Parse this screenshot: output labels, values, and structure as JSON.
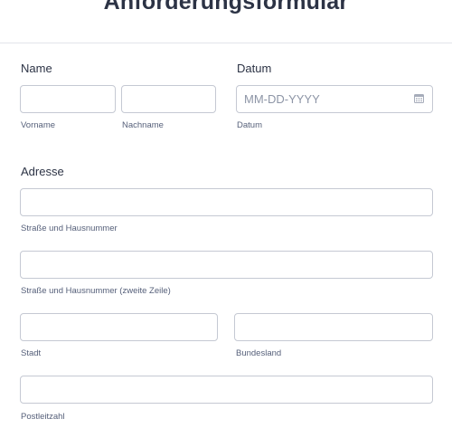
{
  "form": {
    "title": "Anforderungsformular"
  },
  "name": {
    "label": "Name",
    "first_value": "",
    "first_sublabel": "Vorname",
    "last_value": "",
    "last_sublabel": "Nachname"
  },
  "date": {
    "label": "Datum",
    "value": "",
    "placeholder": "MM-DD-YYYY",
    "sublabel": "Datum",
    "icon": "calendar-icon"
  },
  "address": {
    "label": "Adresse",
    "street1_value": "",
    "street1_sublabel": "Straße und Hausnummer",
    "street2_value": "",
    "street2_sublabel": "Straße und Hausnummer (zweite Zeile)",
    "city_value": "",
    "city_sublabel": "Stadt",
    "state_value": "",
    "state_sublabel": "Bundesland",
    "zip_value": "",
    "zip_sublabel": "Postleitzahl"
  },
  "colors": {
    "text": "#2c3345",
    "border": "#c5c9d3",
    "sublabel": "#56607a",
    "placeholder": "#8d95a6"
  }
}
